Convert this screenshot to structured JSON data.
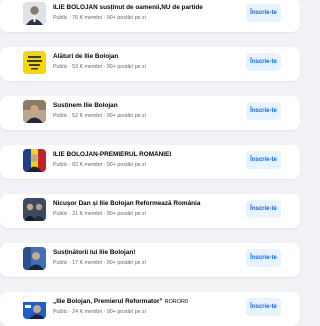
{
  "groups": [
    {
      "title": "ILIE BOLOJAN susținut de oamenii,NU de partide",
      "tag": "",
      "meta": "Public · 76 K membri · 90+ postări pe zi",
      "join": "Înscrie-te",
      "thumb": "portrait-icon",
      "thumb_bg": "#d9dde3"
    },
    {
      "title": "Alături de Ilie Bolojan",
      "tag": "",
      "meta": "Public · 53 K membri · 90+ postări pe zi",
      "join": "Înscrie-te",
      "thumb": "yellow-banner-icon",
      "thumb_bg": "#f4d800"
    },
    {
      "title": "Susținem Ilie Bolojan",
      "tag": "",
      "meta": "Public · 52 K membri · 90+ postări pe zi",
      "join": "Înscrie-te",
      "thumb": "portrait-icon",
      "thumb_bg": "#b9a88e"
    },
    {
      "title": "ILIE BOLOJAN-PREMIERUL ROMÂNIEI",
      "tag": "",
      "meta": "Public · 82 K membri · 90+ postări pe zi",
      "join": "Înscrie-te",
      "thumb": "flag-portrait-icon",
      "thumb_bg": "#1e3f8a"
    },
    {
      "title": "Nicușor Dan și Ilie Bolojan Reformează România",
      "tag": "",
      "meta": "Public · 31 K membri · 90+ postări pe zi",
      "join": "Înscrie-te",
      "thumb": "two-people-icon",
      "thumb_bg": "#3b4a63"
    },
    {
      "title": "Susținătorii lui Ilie Bolojan!",
      "tag": "",
      "meta": "Public · 17 K membri · 90+ postări pe zi",
      "join": "Înscrie-te",
      "thumb": "portrait-icon",
      "thumb_bg": "#3f6fb5"
    },
    {
      "title": "„Ilie Bolojan, Premierul Reformator”",
      "tag": "ROROR0",
      "meta": "Public · 24 K membri · 90+ postări pe zi",
      "join": "Înscrie-te",
      "thumb": "blue-banner-icon",
      "thumb_bg": "#1f5fc9"
    }
  ]
}
